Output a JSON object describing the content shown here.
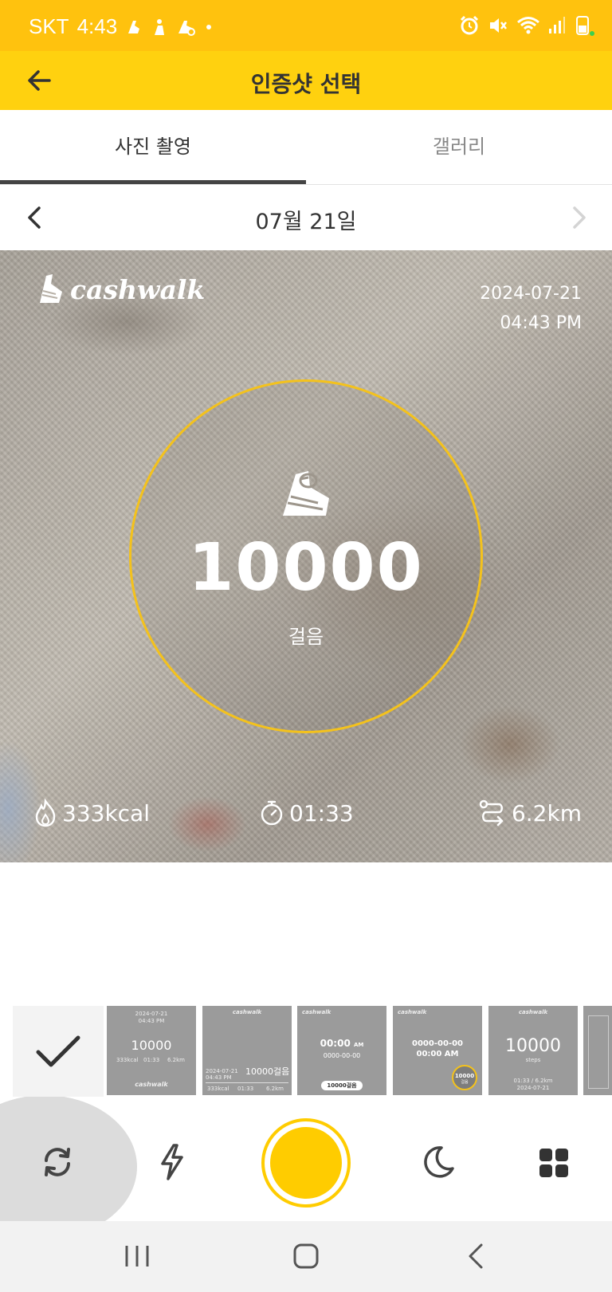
{
  "status_bar": {
    "carrier": "SKT",
    "time": "4:43",
    "icons": [
      "walking-app-icon",
      "walking-app-icon",
      "walking-app-icon",
      "dot-icon",
      "alarm-icon",
      "mute-icon",
      "wifi-icon",
      "signal-icon",
      "battery-icon"
    ]
  },
  "app_bar": {
    "title": "인증샷 선택",
    "back_icon": "arrow-left-icon"
  },
  "tabs": [
    {
      "label": "사진 촬영",
      "active": true
    },
    {
      "label": "갤러리",
      "active": false
    }
  ],
  "date_nav": {
    "date": "07월 21일",
    "prev_icon": "chevron-left-icon",
    "next_icon": "chevron-right-icon"
  },
  "photo": {
    "logo_text": "cashwalk",
    "date": "2024-07-21",
    "time": "04:43 PM",
    "steps": "10000",
    "steps_unit": "걸음",
    "kcal": "333kcal",
    "duration": "01:33",
    "distance": "6.2km",
    "accent_color": "#F4C21C"
  },
  "templates": [
    {
      "id": "tpl-1",
      "main": "10000",
      "top_line": "2024-07-21",
      "top_line2": "04:43 PM",
      "sub": [
        "333kcal",
        "01:33",
        "6.2km"
      ],
      "footer": "cashwalk"
    },
    {
      "id": "tpl-2",
      "header": "cashwalk",
      "main": "10000걸음",
      "left_top": "2024-07-21",
      "left_bottom": "04:43 PM",
      "sub": [
        "333kcal",
        "01:33",
        "6.2km"
      ]
    },
    {
      "id": "tpl-3",
      "header": "cashwalk",
      "main": "00:00",
      "main_suffix": "AM",
      "sub": "0000-00-00",
      "pill": "10000걸음"
    },
    {
      "id": "tpl-4",
      "header": "cashwalk",
      "line1": "0000-00-00",
      "line2": "00:00 AM",
      "badge": "10000",
      "badge_unit": "걸음"
    },
    {
      "id": "tpl-5",
      "header": "cashwalk",
      "main": "10000",
      "sub": "steps",
      "footer1": "01:33 / 6.2km",
      "footer2": "2024-07-21"
    }
  ],
  "controls": {
    "confirm_icon": "check-icon",
    "flip_icon": "camera-flip-icon",
    "flash_icon": "flash-icon",
    "night_icon": "moon-icon",
    "grid_icon": "grid-icon",
    "shutter_color": "#FFCC00"
  },
  "brand": {
    "primary": "#FFD10F",
    "status": "#FFC20E"
  }
}
